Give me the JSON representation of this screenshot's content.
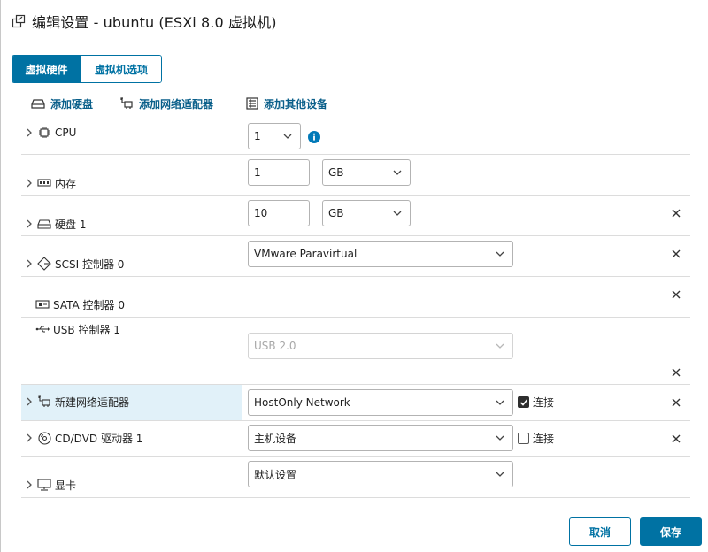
{
  "dialog": {
    "title": "编辑设置 - ubuntu (ESXi 8.0 虚拟机)"
  },
  "tabs": [
    {
      "label": "虚拟硬件",
      "active": true
    },
    {
      "label": "虚拟机选项",
      "active": false
    }
  ],
  "toolbar": {
    "add_disk": "添加硬盘",
    "add_network": "添加网络适配器",
    "add_other": "添加其他设备"
  },
  "hardware": {
    "cpu": {
      "label": "CPU",
      "value": "1"
    },
    "memory": {
      "label": "内存",
      "value": "1",
      "unit": "GB"
    },
    "disk": {
      "label": "硬盘 1",
      "value": "10",
      "unit": "GB"
    },
    "scsi": {
      "label": "SCSI 控制器 0",
      "value": "VMware Paravirtual"
    },
    "sata": {
      "label": "SATA 控制器 0"
    },
    "usb": {
      "label": "USB 控制器 1",
      "value": "USB 2.0"
    },
    "network": {
      "label": "新建网络适配器",
      "value": "HostOnly Network",
      "connect_label": "连接",
      "connected": true
    },
    "cdrom": {
      "label": "CD/DVD 驱动器 1",
      "value": "主机设备",
      "connect_label": "连接",
      "connected": false
    },
    "video": {
      "label": "显卡",
      "value": "默认设置"
    }
  },
  "footer": {
    "cancel": "取消",
    "save": "保存"
  },
  "colors": {
    "accent": "#0072a3",
    "highlight_row": "#e1f1f9",
    "info_icon": "#0079b8"
  },
  "icons": {
    "title": "vm-edit-icon",
    "disk": "hard-disk-icon",
    "network": "network-adapter-icon",
    "other": "device-list-icon",
    "cpu": "cpu-chip-icon",
    "memory": "memory-icon",
    "scsi": "scsi-controller-icon",
    "sata": "sata-controller-icon",
    "usb": "usb-icon",
    "cdrom": "cd-dvd-icon",
    "video": "monitor-icon",
    "info": "info-icon",
    "close": "close-icon",
    "expand": "chevron-right-icon",
    "dropdown": "chevron-down-icon"
  }
}
